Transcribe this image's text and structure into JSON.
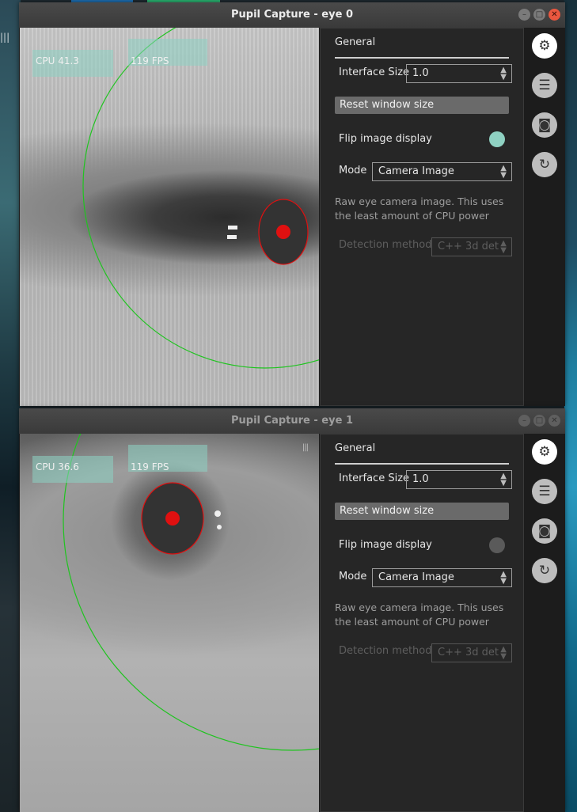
{
  "windows": [
    {
      "title": "Pupil Capture - eye 0",
      "cpu": "CPU 41.3",
      "fps": "119 FPS",
      "general": {
        "header": "General",
        "interface_size_label": "Interface Size",
        "interface_size_value": "1.0",
        "reset_button": "Reset window size",
        "flip_label": "Flip image display",
        "flip_on": true,
        "mode_label": "Mode",
        "mode_value": "Camera Image",
        "description": "Raw eye camera image. This uses the least amount of CPU power",
        "detection_label": "Detection method",
        "detection_value": "C++ 3d det"
      }
    },
    {
      "title": "Pupil Capture - eye 1",
      "cpu": "CPU 36.6",
      "fps": "119 FPS",
      "general": {
        "header": "General",
        "interface_size_label": "Interface Size",
        "interface_size_value": "1.0",
        "reset_button": "Reset window size",
        "flip_label": "Flip image display",
        "flip_on": false,
        "mode_label": "Mode",
        "mode_value": "Camera Image",
        "description": "Raw eye camera image. This uses the least amount of CPU power",
        "detection_label": "Detection method",
        "detection_value": "C++ 3d det"
      }
    }
  ],
  "icons": [
    "settings-gear-icon",
    "plugin-list-icon",
    "camera-icon",
    "3d-model-reset-icon"
  ],
  "colors": {
    "toggle_on": "#8fd1c2",
    "toggle_off": "#5a5a5a",
    "pupil_fit": "#e01010",
    "eye_model": "#1fc41f"
  }
}
